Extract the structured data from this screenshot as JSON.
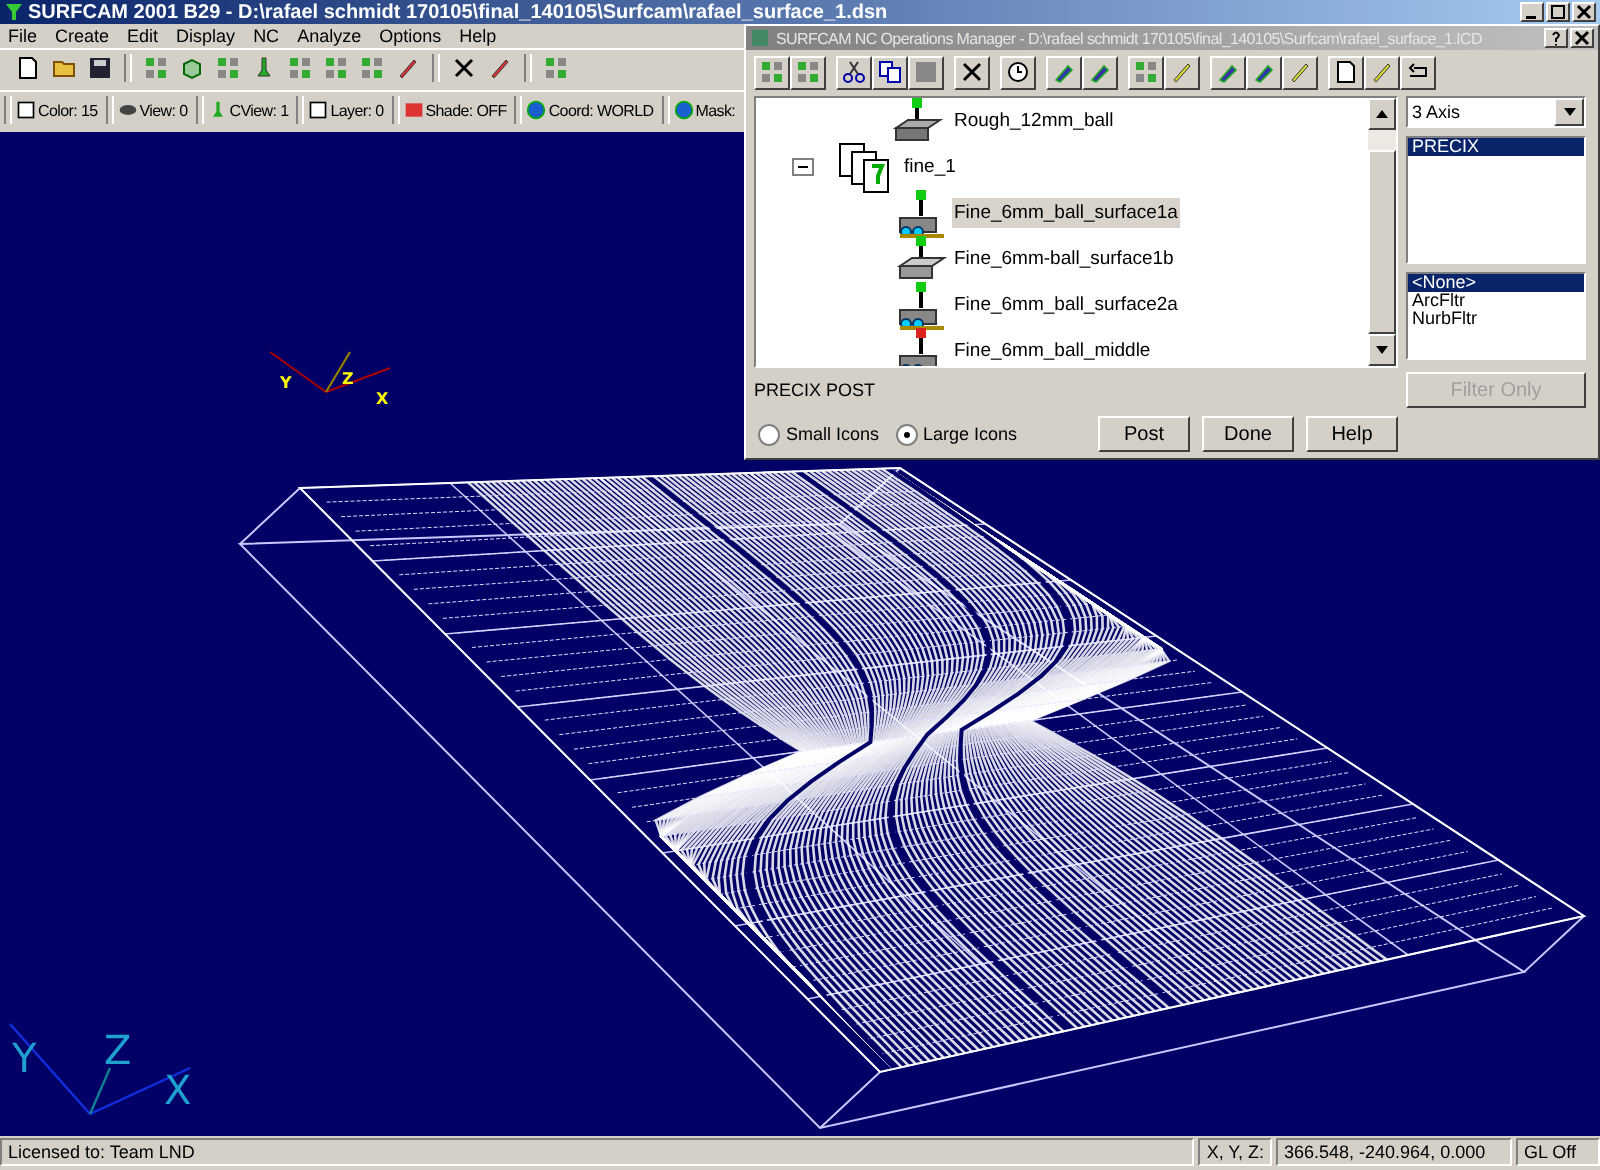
{
  "window": {
    "title": "SURFCAM 2001 B29 - D:\\rafael schmidt 170105\\final_140105\\Surfcam\\rafael_surface_1.dsn"
  },
  "menu": [
    "File",
    "Create",
    "Edit",
    "Display",
    "NC",
    "Analyze",
    "Options",
    "Help"
  ],
  "status_toolbar": [
    "Color: 15",
    "View: 0",
    "CView: 1",
    "Layer: 0",
    "Shade: OFF",
    "Coord: WORLD",
    "Mask:"
  ],
  "viewport": {
    "axis_labels": [
      "Y",
      "Z",
      "X"
    ],
    "work_triad_labels": [
      "Y",
      "Z",
      "X"
    ]
  },
  "dialog": {
    "title": "SURFCAM NC Operations Manager - D:\\rafael schmidt 170105\\final_140105\\Surfcam\\rafael_surface_1.ICD",
    "tree": [
      {
        "label": "Rough_12mm_ball",
        "selected": false,
        "kind": "rough"
      },
      {
        "label": "fine_1",
        "selected": false,
        "kind": "group",
        "expanded": true,
        "children": [
          {
            "label": "Fine_6mm_ball_surface1a",
            "selected": true,
            "kind": "surface"
          },
          {
            "label": "Fine_6mm-ball_surface1b",
            "selected": false,
            "kind": "block"
          },
          {
            "label": "Fine_6mm_ball_surface2a",
            "selected": false,
            "kind": "surface"
          },
          {
            "label": "Fine_6mm_ball_middle",
            "selected": false,
            "kind": "middle"
          }
        ]
      }
    ],
    "axis_dropdown": {
      "value": "3 Axis"
    },
    "posts": [
      {
        "label": "PRECIX",
        "selected": true
      }
    ],
    "filters": [
      {
        "label": "<None>",
        "selected": true
      },
      {
        "label": "ArcFltr",
        "selected": false
      },
      {
        "label": "NurbFltr",
        "selected": false
      }
    ],
    "post_label": "PRECIX POST",
    "filter_button": {
      "label": "Filter Only",
      "disabled": true
    },
    "icon_size": [
      {
        "label": "Small Icons",
        "selected": false
      },
      {
        "label": "Large Icons",
        "selected": true
      }
    ],
    "buttons": [
      "Post",
      "Done",
      "Help"
    ]
  },
  "status_bar": {
    "license": "Licensed to: Team LND",
    "coord_label": "X, Y, Z:",
    "coords": "366.548, -240.964, 0.000",
    "gl": "GL Off"
  }
}
